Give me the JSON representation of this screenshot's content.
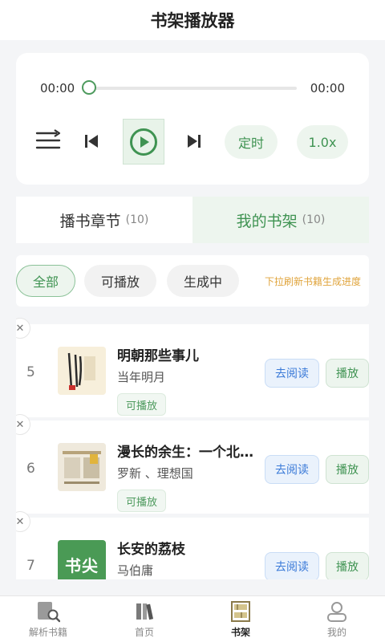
{
  "header": {
    "title": "书架播放器"
  },
  "player": {
    "current_time": "00:00",
    "duration": "00:00",
    "progress": 0,
    "timer_label": "定时",
    "speed_label": "1.0x"
  },
  "tabs": [
    {
      "label": "播书章节",
      "count": "(10)"
    },
    {
      "label": "我的书架",
      "count": "(10)"
    }
  ],
  "filters": {
    "chips": [
      "全部",
      "可播放",
      "生成中"
    ],
    "hint": "下拉刷新书籍生成进度"
  },
  "books": [
    {
      "index": "5",
      "title": "明朝那些事儿",
      "author": "当年明月",
      "status": "可播放",
      "read_label": "去阅读",
      "play_label": "播放"
    },
    {
      "index": "6",
      "title": "漫长的余生：一个北魏宫女和她的时代",
      "author": "罗新 、理想国",
      "status": "可播放",
      "read_label": "去阅读",
      "play_label": "播放"
    },
    {
      "index": "7",
      "title": "长安的荔枝",
      "author": "马伯庸",
      "cover_text": "书尖",
      "read_label": "去阅读",
      "play_label": "播放"
    }
  ],
  "tabbar": [
    {
      "label": "解析书籍",
      "icon": "scan-book-icon"
    },
    {
      "label": "首页",
      "icon": "books-icon"
    },
    {
      "label": "书架",
      "icon": "bookshelf-icon"
    },
    {
      "label": "我的",
      "icon": "user-icon"
    }
  ],
  "colors": {
    "accent": "#3f9352",
    "link": "#3a7ad8",
    "hint": "#e0a43c"
  }
}
